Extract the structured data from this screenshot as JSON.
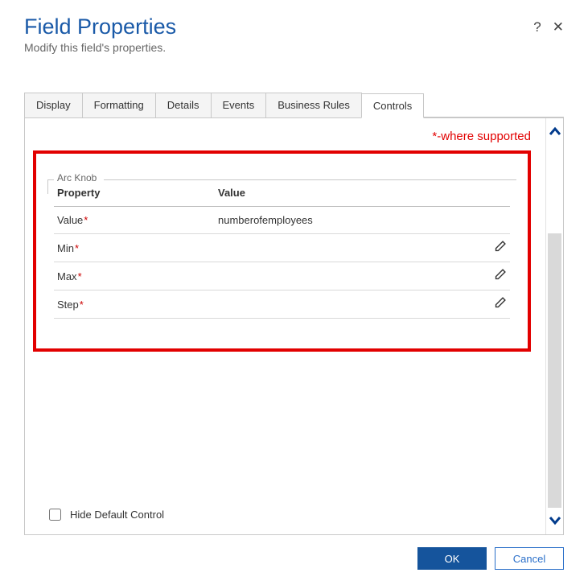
{
  "title": "Field Properties",
  "subtitle": "Modify this field's properties.",
  "tabs": [
    "Display",
    "Formatting",
    "Details",
    "Events",
    "Business Rules",
    "Controls"
  ],
  "active_tab": 5,
  "annotation": "*-where supported",
  "fieldset_legend": "Arc Knob",
  "grid": {
    "headers": {
      "property": "Property",
      "value": "Value"
    },
    "rows": [
      {
        "label": "Value",
        "required": true,
        "value": "numberofemployees",
        "editable": false
      },
      {
        "label": "Min",
        "required": true,
        "value": "",
        "editable": true
      },
      {
        "label": "Max",
        "required": true,
        "value": "",
        "editable": true
      },
      {
        "label": "Step",
        "required": true,
        "value": "",
        "editable": true
      }
    ]
  },
  "hide_default_label": "Hide Default Control",
  "buttons": {
    "ok": "OK",
    "cancel": "Cancel"
  }
}
